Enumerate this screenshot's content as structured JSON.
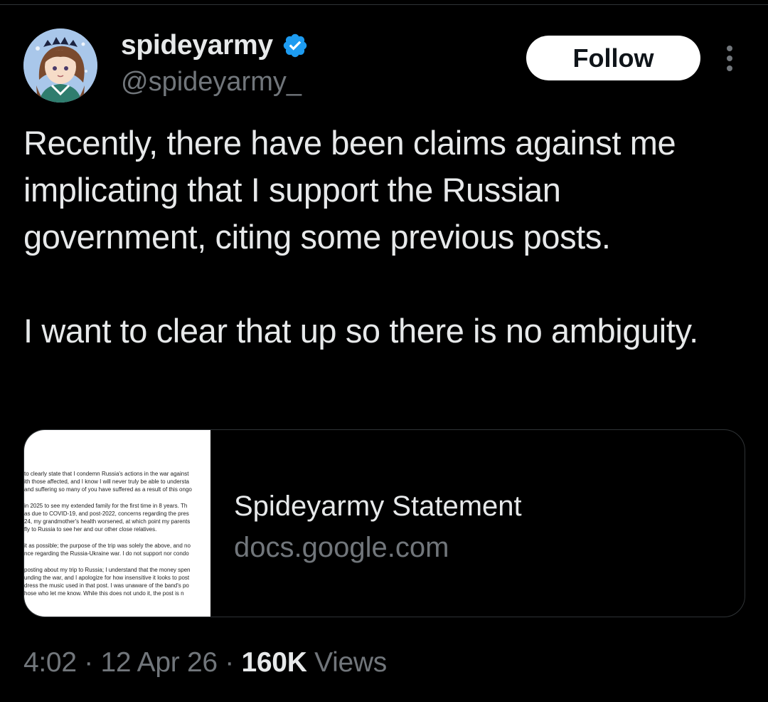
{
  "author": {
    "display_name": "spideyarmy",
    "handle": "@spideyarmy_",
    "verified_icon": "verified-badge-icon",
    "verified_color": "#1d9bf0",
    "avatar_icon": "avatar-illustration"
  },
  "actions": {
    "follow_label": "Follow",
    "more_icon": "more-options-icon"
  },
  "tweet": {
    "paragraphs": [
      "Recently, there have been claims against me implicating that I support the Russian government, citing some previous posts.",
      "I want to clear that up so there is no ambiguity."
    ]
  },
  "link_card": {
    "title": "Spideyarmy Statement",
    "domain": "docs.google.com",
    "thumbnail_lines": [
      [
        "to clearly state that I condemn Russia's actions in the war against",
        "ith those affected, and I know I will never truly be able to understa",
        "and suffering so many of you have suffered as a result of this ongo"
      ],
      [
        "in 2025 to see my extended family for the first time in 8 years. Th",
        "as due to COVID-19, and post-2022, concerns regarding the pres",
        "24, my grandmother's health worsened, at which point my parents",
        "fly to Russia to see her and our other close relatives."
      ],
      [
        "it as possible; the purpose of the trip was solely the above, and no",
        "nce regarding the Russia-Ukraine war. I do not support nor condo"
      ],
      [
        "posting about my trip to Russia; I understand that the money spen",
        "unding the war, and I apologize for how insensitive it looks to post",
        "dress the music used in that post. I was unaware of the band's po",
        "hose who let me know. While this does not undo it, the post is n"
      ]
    ]
  },
  "meta": {
    "time": "4:02",
    "separator": " · ",
    "date": "12 Apr 26",
    "views_count": "160K",
    "views_label": " Views"
  },
  "colors": {
    "background": "#000000",
    "text_primary": "#e7e9ea",
    "text_secondary": "#71767b",
    "border": "#2f3336",
    "follow_bg": "#ffffff",
    "follow_text": "#0f1419"
  }
}
